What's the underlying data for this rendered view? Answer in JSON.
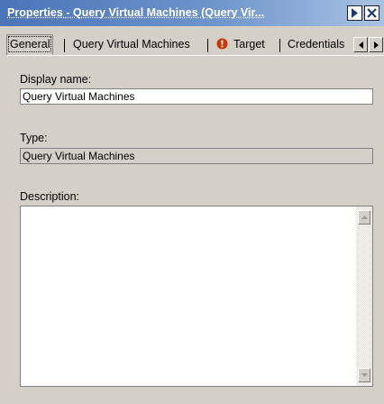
{
  "window": {
    "title": "Properties - Query Virtual Machines (Query Vir...",
    "title_bg": "#4a74b8"
  },
  "tabs": [
    {
      "label": "General",
      "active": true
    },
    {
      "label": "Query Virtual Machines"
    },
    {
      "label": "Target",
      "icon": "error-icon"
    },
    {
      "label": "Credentials"
    }
  ],
  "general": {
    "display_name_label": "Display name:",
    "display_name_value": "Query Virtual Machines",
    "type_label": "Type:",
    "type_value": "Query Virtual Machines",
    "description_label": "Description:",
    "description_value": ""
  },
  "colors": {
    "face": "#d4d0c8",
    "error": "#cc3300"
  }
}
